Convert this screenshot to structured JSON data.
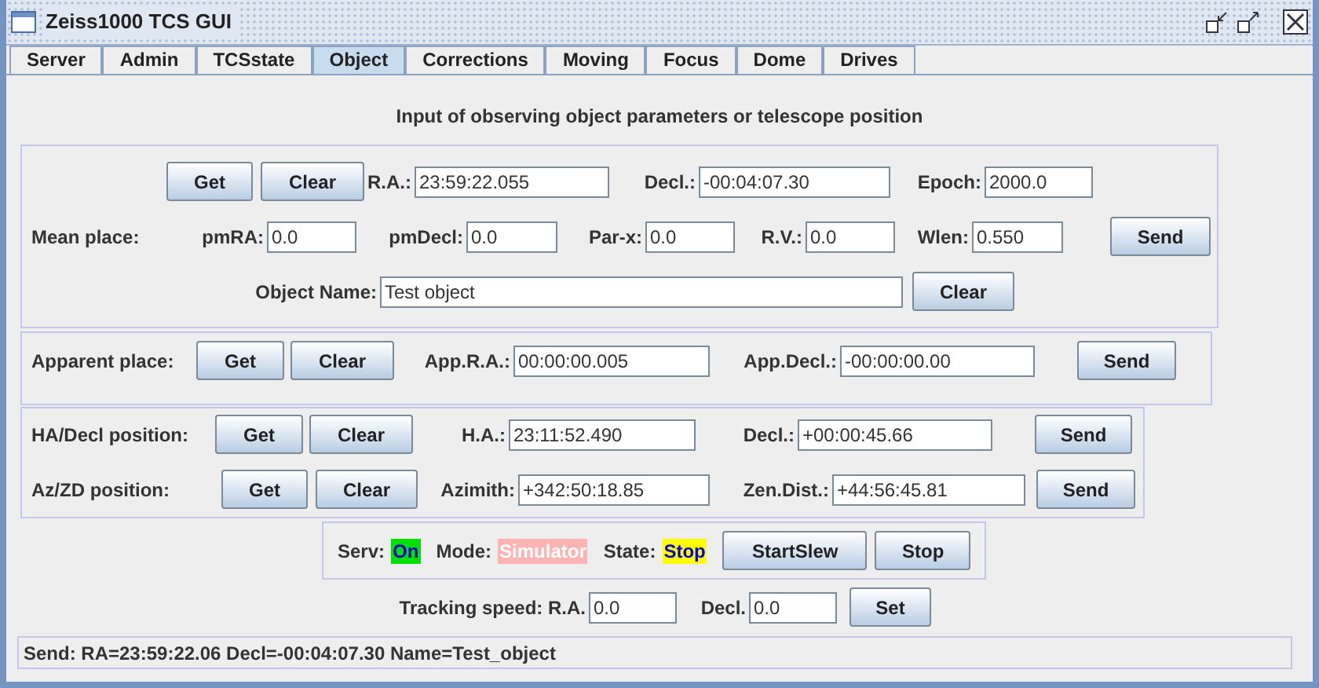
{
  "window": {
    "title": "Zeiss1000 TCS GUI"
  },
  "tabs": [
    {
      "label": "Server",
      "selected": false
    },
    {
      "label": "Admin",
      "selected": false
    },
    {
      "label": "TCSstate",
      "selected": false
    },
    {
      "label": "Object",
      "selected": true
    },
    {
      "label": "Corrections",
      "selected": false
    },
    {
      "label": "Moving",
      "selected": false
    },
    {
      "label": "Focus",
      "selected": false
    },
    {
      "label": "Dome",
      "selected": false
    },
    {
      "label": "Drives",
      "selected": false
    }
  ],
  "heading": "Input of observing object parameters or telescope position",
  "mean_place": {
    "label": "Mean place:",
    "get": "Get",
    "clear": "Clear",
    "ra": {
      "label": "R.A.:",
      "value": "23:59:22.055"
    },
    "decl": {
      "label": "Decl.:",
      "value": "-00:04:07.30"
    },
    "epoch": {
      "label": "Epoch:",
      "value": "2000.0"
    },
    "pm_ra": {
      "label": "pmRA:",
      "value": "0.0"
    },
    "pm_decl": {
      "label": "pmDecl:",
      "value": "0.0"
    },
    "parallax": {
      "label": "Par-x:",
      "value": "0.0"
    },
    "rv": {
      "label": "R.V.:",
      "value": "0.0"
    },
    "wlen": {
      "label": "Wlen:",
      "value": "0.550"
    },
    "send": "Send",
    "object_name": {
      "label": "Object Name:",
      "value": "Test object"
    },
    "clear_name": "Clear"
  },
  "apparent_place": {
    "label": "Apparent place:",
    "get": "Get",
    "clear": "Clear",
    "ra": {
      "label": "App.R.A.:",
      "value": "00:00:00.005"
    },
    "decl": {
      "label": "App.Decl.:",
      "value": "-00:00:00.00"
    },
    "send": "Send"
  },
  "ha_decl": {
    "label": "HA/Decl position:",
    "get": "Get",
    "clear": "Clear",
    "ha": {
      "label": "H.A.:",
      "value": "23:11:52.490"
    },
    "decl": {
      "label": "Decl.:",
      "value": "+00:00:45.66"
    },
    "send": "Send"
  },
  "az_zd": {
    "label": "Az/ZD position:",
    "get": "Get",
    "clear": "Clear",
    "az": {
      "label": "Azimith:",
      "value": "+342:50:18.85"
    },
    "zd": {
      "label": "Zen.Dist.:",
      "value": "+44:56:45.81"
    },
    "send": "Send"
  },
  "status": {
    "indicators": [
      {
        "label": "Serv:",
        "value": "On",
        "color": "#00e000"
      },
      {
        "label": "Mode:",
        "value": "Simulator",
        "color": "#ffb4b4"
      },
      {
        "label": "State:",
        "value": "Stop",
        "color": "#ffff00"
      }
    ],
    "buttons": [
      "StartSlew",
      "Stop"
    ]
  },
  "tracking": {
    "label": "Tracking speed: R.A.",
    "ra": "0.0",
    "decl_label": "Decl.",
    "decl": "0.0",
    "set": "Set"
  },
  "status_bar": "Send: RA=23:59:22.06 Decl=-00:04:07.30 Name=Test_object"
}
